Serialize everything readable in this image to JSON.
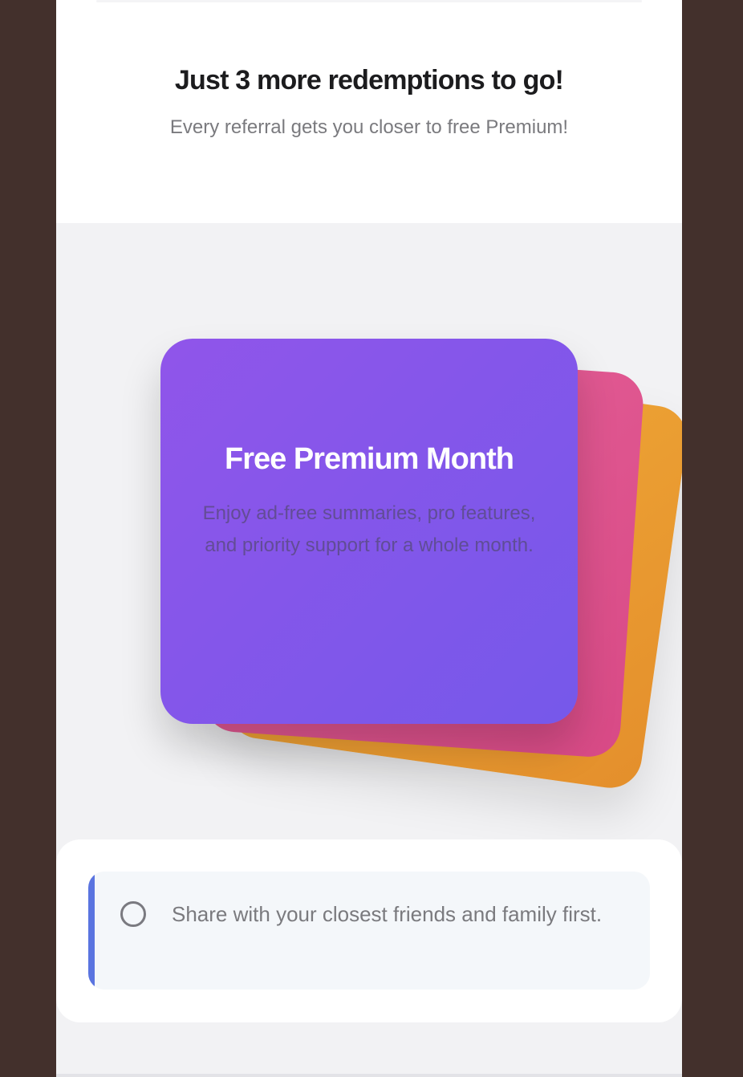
{
  "header": {
    "headline": "Just 3 more redemptions to go!",
    "subline": "Every referral gets you closer to free Premium!"
  },
  "reward_card": {
    "title": "Free Premium Month",
    "description": "Enjoy ad-free summaries, pro features, and priority support for a whole month."
  },
  "tips": [
    {
      "text": "Share with your closest friends and family first.",
      "checked": false
    }
  ],
  "colors": {
    "background": "#43302c",
    "card_purple": "#8257ea",
    "card_pink": "#de5590",
    "card_orange": "#eca034",
    "tip_accent": "#5a74e0"
  }
}
